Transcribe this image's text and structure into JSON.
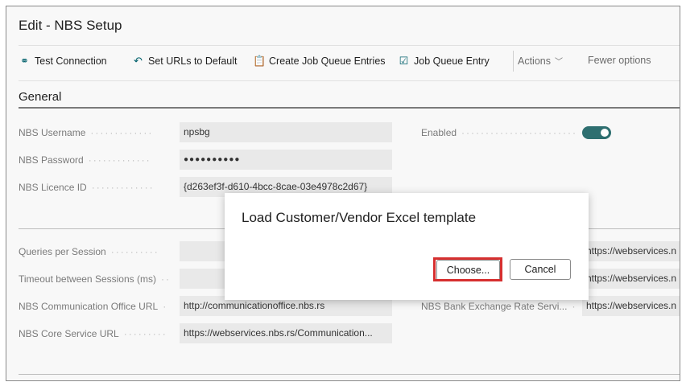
{
  "page": {
    "title": "Edit - NBS Setup"
  },
  "toolbar": {
    "test_connection": "Test Connection",
    "set_urls_default": "Set URLs to Default",
    "create_job_queue": "Create Job Queue Entries",
    "job_queue_entry": "Job Queue Entry",
    "actions": "Actions",
    "fewer_options": "Fewer options"
  },
  "general": {
    "title": "General",
    "username_label": "NBS Username",
    "username_value": "npsbg",
    "password_label": "NBS Password",
    "password_value": "●●●●●●●●●●",
    "licence_label": "NBS Licence ID",
    "licence_value": "{d263ef3f-d610-4bcc-8cae-03e4978c2d67}",
    "enabled_label": "Enabled",
    "enabled_value": true
  },
  "connection": {
    "queries_label": "Queries per Session",
    "timeout_label": "Timeout between Sessions (ms)",
    "comm_office_label": "NBS Communication Office URL",
    "comm_office_value": "http://communicationoffice.nbs.rs",
    "core_service_label": "NBS Core Service URL",
    "core_service_value": "https://webservices.nbs.rs/Communication...",
    "right_value_1": "https://webservices.n",
    "right_value_2": "https://webservices.n",
    "bank_rate_label": "NBS Bank Exchange Rate Servi...",
    "bank_rate_value": "https://webservices.n"
  },
  "dialog": {
    "title": "Load Customer/Vendor Excel template",
    "choose": "Choose...",
    "cancel": "Cancel"
  },
  "colors": {
    "accent": "#00606b",
    "toggle": "#2e6f70",
    "highlight": "#d62f2f"
  }
}
